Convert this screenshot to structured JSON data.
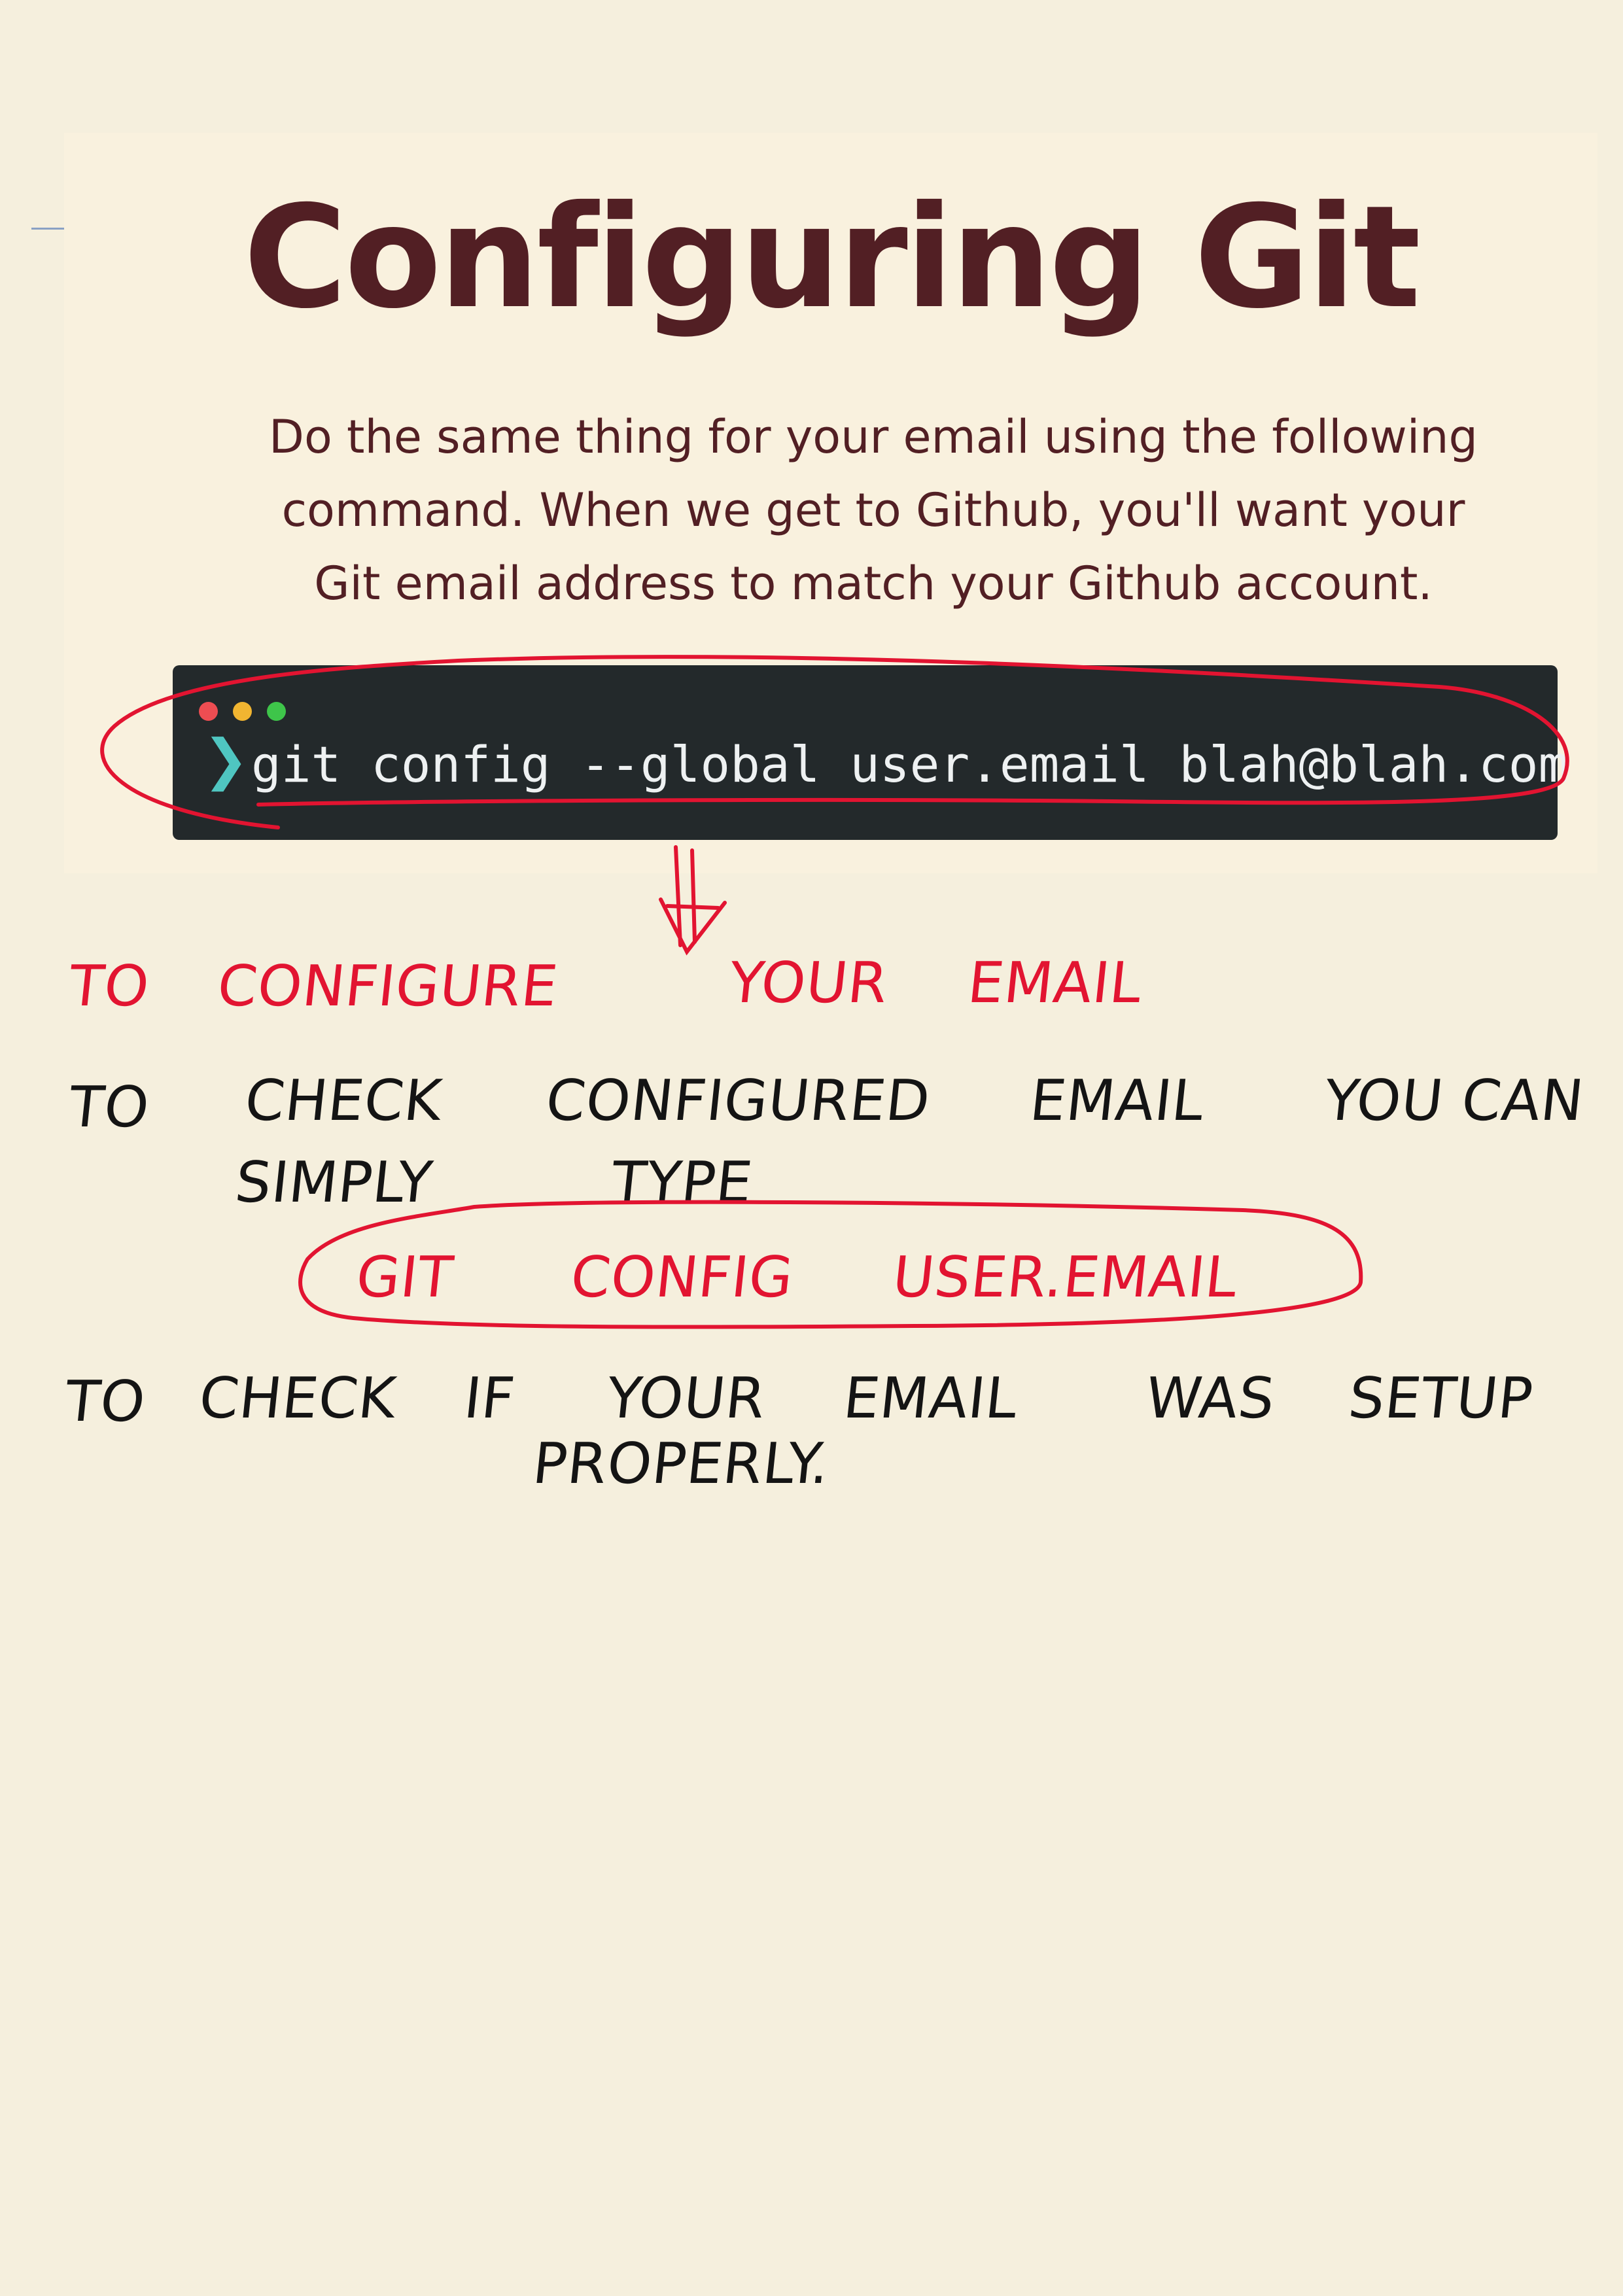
{
  "slide": {
    "title": "Configuring Git",
    "text_lines": [
      "Do the same thing for your email using the following",
      "command.  When we get to Github, you'll want your",
      "Git email address to match your Github account."
    ]
  },
  "terminal": {
    "prompt": "❯",
    "command": "git config --global user.email blah@blah.com"
  },
  "notes": {
    "line1": {
      "w1": "TO",
      "w2": "CONFIGURE",
      "w3": "YOUR",
      "w4": "EMAIL"
    },
    "line2": {
      "w1": "TO",
      "w2": "CHECK",
      "w3": "CONFIGURED",
      "w4": "EMAIL",
      "w5": "YOU CAN"
    },
    "line3": {
      "w1": "SIMPLY",
      "w2": "TYPE"
    },
    "command": {
      "w1": "GIT",
      "w2": "CONFIG",
      "w3": "USER.EMAIL"
    },
    "line4": {
      "w1": "TO",
      "w2": "CHECK",
      "w3": "IF",
      "w4": "YOUR",
      "w5": "EMAIL",
      "w6": "WAS",
      "w7": "SETUP"
    },
    "line5": {
      "w1": "PROPERLY."
    }
  },
  "colors": {
    "page_background": "#f5efdd",
    "slide_background": "#f9f1de",
    "title": "#521f24",
    "terminal_background": "#23292b",
    "terminal_text": "#eef1f2",
    "prompt": "#4fc6c1",
    "red_ink": "#e21431",
    "black_ink": "#141414"
  },
  "icons": {
    "window_controls": [
      "close-dot-icon",
      "minimize-dot-icon",
      "maximize-dot-icon"
    ],
    "prompt": "chevron-right-icon",
    "annotation": "down-arrow-icon"
  }
}
